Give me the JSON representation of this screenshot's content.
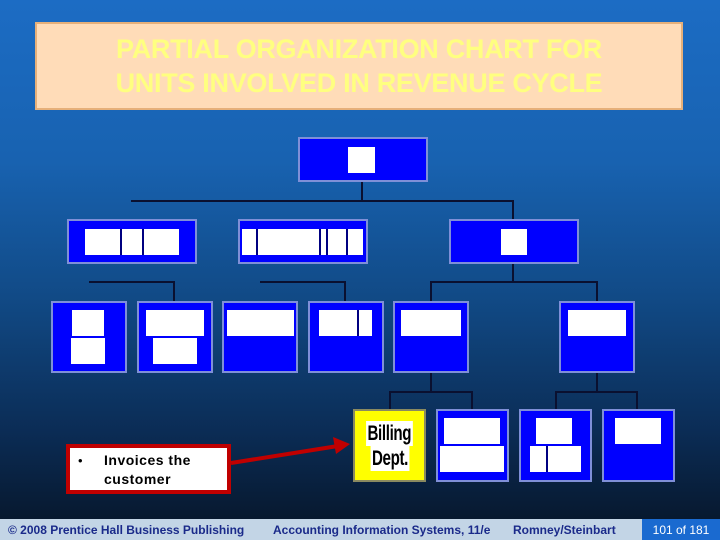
{
  "slide": {
    "title_lines": [
      "PARTIAL ORGANIZATION CHART FOR",
      "UNITS INVOLVED IN REVENUE CYCLE"
    ],
    "highlighted_unit": [
      "Billing",
      "Dept."
    ],
    "callout": {
      "bullet": "•",
      "text_lines": [
        "Invoices the",
        "customer"
      ]
    },
    "colors": {
      "background": "#1862b0",
      "node_fill": "#0000ff",
      "highlight_fill": "#ffff00",
      "title_fill": "#ffdcb8",
      "title_text": "#ffff80",
      "callout_border": "#c00000",
      "arrow": "#c00000"
    }
  },
  "footer": {
    "copyright": "© 2008 Prentice Hall Business Publishing",
    "book": "Accounting Information Systems, 11/e",
    "authors": "Romney/Steinbart",
    "page": "101 of 181"
  }
}
